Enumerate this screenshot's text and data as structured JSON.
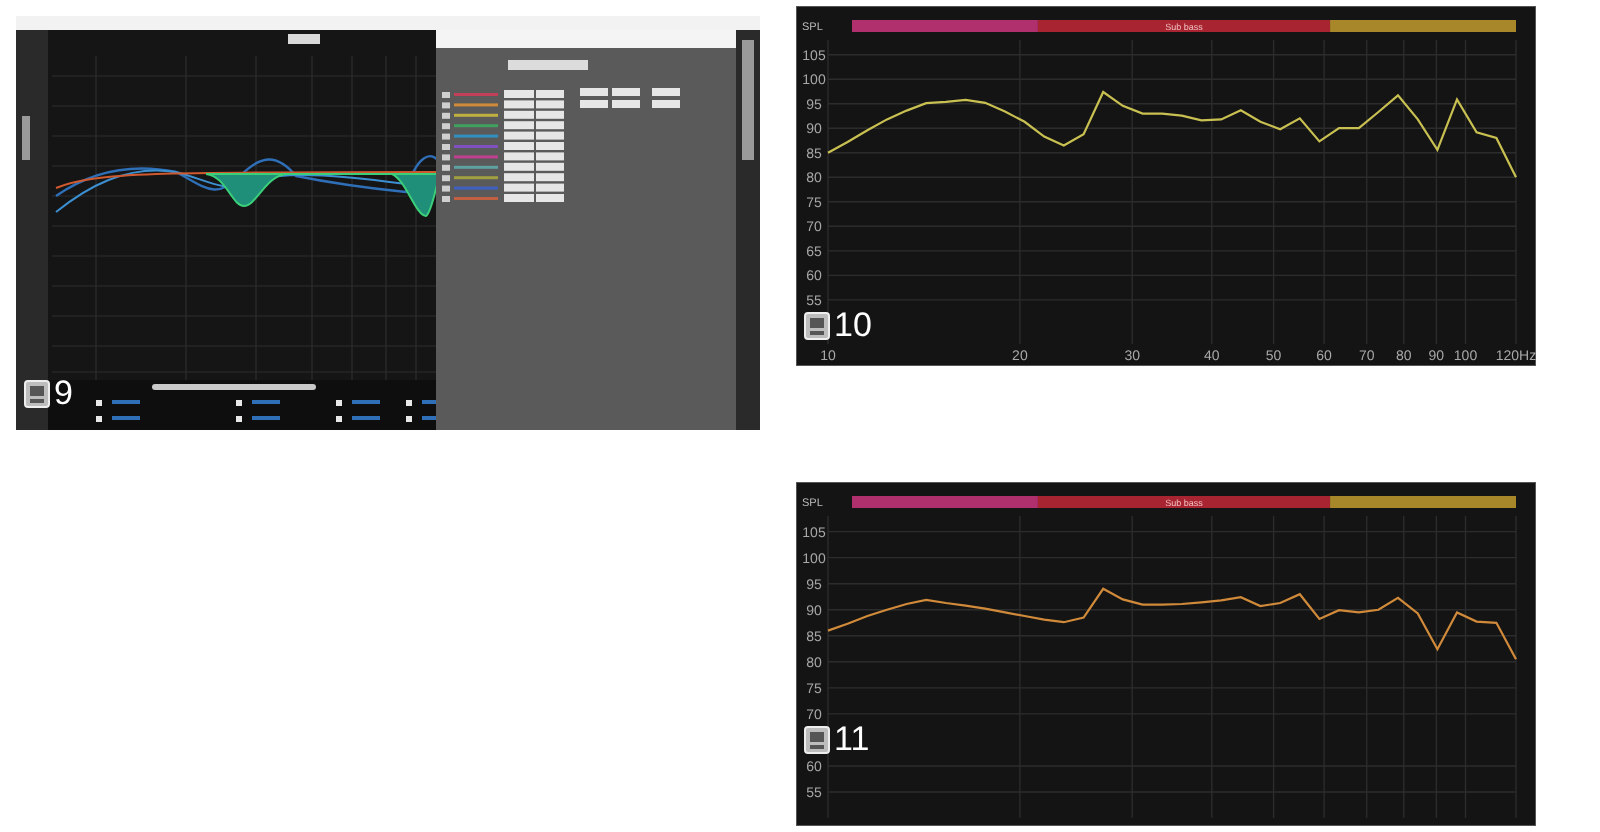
{
  "panels": [
    {
      "kind": "eq_window",
      "number": "9"
    },
    {
      "kind": "spl_chart",
      "number": "10",
      "bands": [
        {
          "color": "#b0306e"
        },
        {
          "label": "Sub bass",
          "color": "#a82430"
        },
        {
          "color": "#a8862a"
        }
      ],
      "frequency_labels": [
        "10",
        "20",
        "30",
        "40",
        "50",
        "60",
        "70",
        "80",
        "90",
        "100",
        "120Hz"
      ],
      "chart_data": {
        "type": "line",
        "ylabel": "SPL",
        "categories": [
          null,
          null,
          null,
          null,
          null,
          null,
          null,
          null,
          null,
          null,
          null,
          null,
          null,
          null,
          null,
          null,
          null,
          null,
          null,
          null,
          null,
          null,
          null,
          null,
          null,
          null,
          null,
          null,
          null,
          null,
          null,
          null,
          null,
          null,
          null,
          null
        ],
        "series": [
          {
            "color": "#c9c052",
            "values": [
              85,
              87.2,
              89.6,
              91.8,
              93.6,
              95.1,
              95.4,
              95.8,
              95.2,
              93.4,
              91.3,
              88.3,
              86.5,
              88.8,
              97.4,
              94.6,
              93,
              93,
              92.6,
              91.6,
              91.8,
              93.7,
              91.3,
              89.8,
              92,
              87.3,
              90,
              90,
              93.3,
              96.7,
              91.8,
              85.6,
              95.9,
              89.2,
              88,
              80
            ]
          }
        ],
        "ylim": [
          46,
          108
        ],
        "yticks": [
          55,
          60,
          65,
          70,
          75,
          80,
          85,
          90,
          95,
          100,
          105
        ],
        "grid": true
      }
    },
    {
      "kind": "spl_chart",
      "number": "11",
      "bands": [
        {
          "color": "#b0306e"
        },
        {
          "label": "Sub bass",
          "color": "#a82430"
        },
        {
          "color": "#a8862a"
        }
      ],
      "chart_data": {
        "type": "line",
        "ylabel": "SPL",
        "categories": [
          null,
          null,
          null,
          null,
          null,
          null,
          null,
          null,
          null,
          null,
          null,
          null,
          null,
          null,
          null,
          null,
          null,
          null,
          null,
          null,
          null,
          null,
          null,
          null,
          null,
          null,
          null,
          null,
          null,
          null,
          null,
          null,
          null,
          null,
          null,
          null
        ],
        "series": [
          {
            "color": "#d08a3a",
            "values": [
              86,
              87.3,
              88.8,
              90,
              91.1,
              91.9,
              91.3,
              90.8,
              90.2,
              89.5,
              88.8,
              88.1,
              87.6,
              88.5,
              94,
              92,
              91,
              91,
              91.1,
              91.4,
              91.8,
              92.4,
              90.7,
              91.3,
              93,
              88.2,
              89.9,
              89.5,
              90,
              92.3,
              89.3,
              82.4,
              89.5,
              87.7,
              87.5,
              80.5
            ]
          }
        ],
        "ylim": [
          50,
          108
        ],
        "yticks": [
          55,
          60,
          70,
          75,
          80,
          85,
          90,
          95,
          100,
          105
        ],
        "grid": true
      }
    }
  ]
}
